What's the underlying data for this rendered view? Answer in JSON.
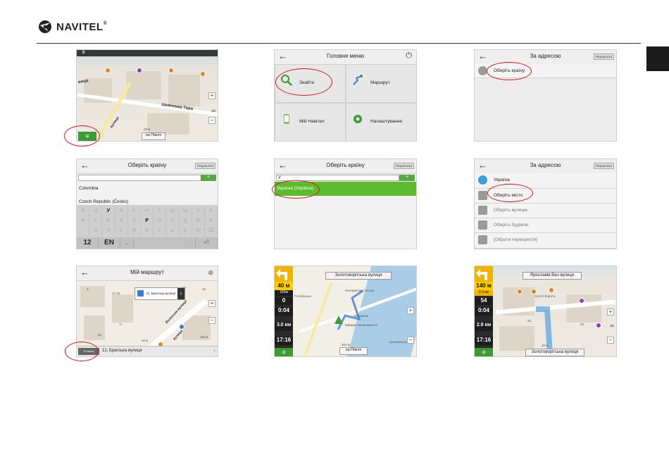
{
  "header": {
    "brand": "NAVITEL",
    "reg_mark": "®",
    "colors": {
      "accent_red": "#d8141e",
      "navitel_green": "#3e9a35",
      "side_tab": "#1a1a1a"
    }
  },
  "screen1": {
    "street_label": "Шевченка Тара",
    "street_label_left": "вица",
    "street_label_rot": "вулиця",
    "distance_small": "30 м",
    "north_button": "на Північ",
    "mode_label": "2D",
    "speed_badge": "0",
    "menu_icon": "menu-icon"
  },
  "screen2": {
    "title": "Головне меню",
    "tiles": [
      "Знайти",
      "Маршрут",
      "Мій Навітел",
      "Налаштування"
    ]
  },
  "screen3": {
    "title": "За адресою",
    "results_button": "Результати",
    "rows": [
      "Оберіть країну"
    ]
  },
  "screen4": {
    "title": "Оберіть країну",
    "results_button": "Результати",
    "input_value": "",
    "countries": [
      "Colombia",
      "Czech Republic (Česko)"
    ],
    "keyboard_rows": [
      [
        "Й",
        "Ц",
        "У",
        "К",
        "Е",
        "Н",
        "Г",
        "Ш",
        "Щ",
        "З",
        "Х"
      ],
      [
        "Ф",
        "І",
        "В",
        "А",
        "П",
        "Р",
        "О",
        "Л",
        "Д",
        "Ж",
        "Є"
      ],
      [
        "",
        "Я",
        "Ч",
        "С",
        "М",
        "И",
        "Т",
        "Ь",
        "Б",
        "Ю",
        "⌫"
      ]
    ],
    "enabled_keys": [
      "У",
      "Р"
    ],
    "bottom_keys": [
      "12",
      "EN",
      ".",
      "",
      "⏎"
    ]
  },
  "screen5": {
    "title": "Оберіть країну",
    "results_button": "Результати",
    "input_value": "У",
    "highlighted_country": "Україна (Україна)"
  },
  "screen6": {
    "title": "За адресою",
    "results_button": "Результати",
    "rows": [
      "Україна",
      "Оберіть місто",
      "Оберіть вулицю",
      "Оберіть будівлю",
      "[Обрати перехрестя]"
    ]
  },
  "screen7": {
    "title": "Мій маршрут",
    "popup_label": "12, Братська вулиця",
    "bottom_label": "12, Братська вулиця",
    "start_button": "Поїхали",
    "street_map_1": "Волоська вулиця",
    "street_map_2": "вулиця",
    "numbers": [
      "17-19",
      "7с",
      "3",
      "16",
      "10",
      "15/13",
      "5а"
    ],
    "distance_small": "30 м"
  },
  "screen8": {
    "street_banner": "Золотоворітська вулиця",
    "turn_distance": "40 м",
    "turn_sub": "160м",
    "speed": "0",
    "time_remaining": "0:04",
    "distance_remaining": "3.0 км",
    "clock": "17:16",
    "north_button": "на Північ",
    "distance_scale": "300 м",
    "pois": [
      "Контрактова площа",
      "Хрещатик",
      "Майдан Незалежності",
      "Арсенальна"
    ],
    "map_label_left": "Гоголівська"
  },
  "screen9": {
    "top_banner": "Ярославів Вал вулиця",
    "bottom_banner": "Золотоворітська вулиця",
    "turn_distance": "140 м",
    "turn_sub": "2.2 км",
    "speed": "54",
    "time_remaining": "0:04",
    "distance_remaining": "2.9 км",
    "clock": "17:16",
    "mode_label": "2D",
    "poi_label": "Золоті Ворота",
    "numbers": [
      "34",
      "20"
    ],
    "distance_small": "30 м"
  }
}
